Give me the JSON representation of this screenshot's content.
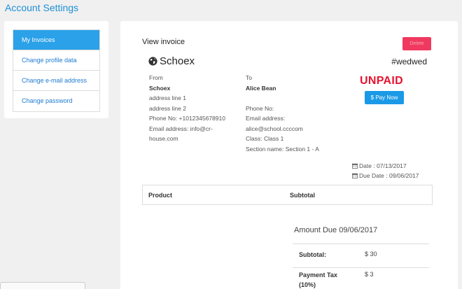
{
  "page": {
    "title": "Account Settings"
  },
  "sidebar": {
    "items": [
      {
        "label": "My Invoices"
      },
      {
        "label": "Change profile data"
      },
      {
        "label": "Change e-mail address"
      },
      {
        "label": "Change password"
      }
    ]
  },
  "invoice": {
    "view_title": "View invoice",
    "delete_label": "Delete",
    "brand": "Schoex",
    "number": "#wedwed",
    "from": {
      "heading": "From",
      "name": "Schoex",
      "lines": [
        "address line 1",
        "address line 2",
        "Phone No: +1012345678910",
        "Email address: info@cr-",
        "house.com"
      ]
    },
    "to": {
      "heading": "To",
      "name": "Alice Bean",
      "lines": [
        "Phone No:",
        "Email address:",
        "alice@school.ccccom",
        "Class: Class 1",
        "Section name: Section 1 - A"
      ]
    },
    "status": "UNPAID",
    "pay_label": "$ Pay Now",
    "date": "Date : 07/13/2017",
    "due_date": "Due Date : 09/06/2017",
    "table": {
      "headers": [
        "Product",
        "Subtotal"
      ]
    },
    "amount_due": "Amount Due 09/06/2017",
    "totals": [
      {
        "label": "Subtotal:",
        "value": "$ 30"
      },
      {
        "label": "Payment Tax (10%)",
        "value": "$ 3"
      }
    ]
  },
  "colors": {
    "accent": "#2aa1e8",
    "link": "#1f7bd1",
    "danger": "#f0395f",
    "unpaid": "#e8132f"
  }
}
